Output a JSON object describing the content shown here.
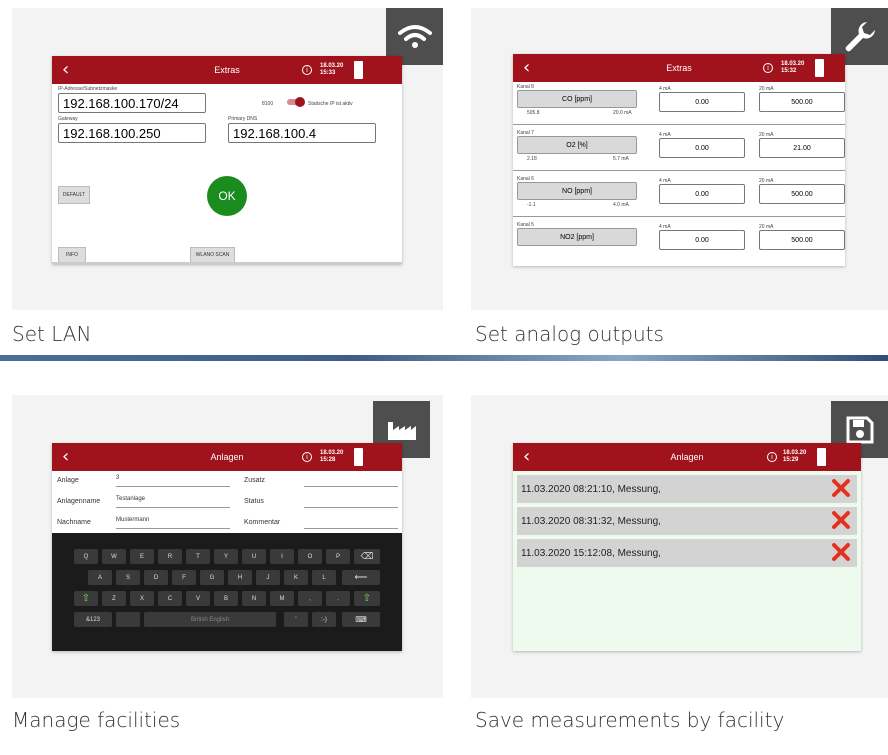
{
  "tiles": [
    {
      "caption": "Set LAN",
      "icon": "wifi-icon",
      "screen": {
        "title": "Extras",
        "date": "18.03.20",
        "time": "15:33",
        "ip_label": "IP-Adresse/Subnetzmaske",
        "ip_value": "192.168.100.170/24",
        "port": "8100",
        "static_label": "Statische IP ist aktiv",
        "gateway_label": "Gateway",
        "gateway_value": "192.168.100.250",
        "dns_label": "Primary DNS",
        "dns_value": "192.168.100.4",
        "default_btn": "DEFAULT",
        "ok_btn": "OK",
        "info_btn": "INFO",
        "wlan_btn": "WLANO SCAN"
      }
    },
    {
      "caption": "Set analog outputs",
      "icon": "wrench-icon",
      "screen": {
        "title": "Extras",
        "date": "18.03.20",
        "time": "15:32",
        "channels": [
          {
            "kanal": "Kanal 8",
            "name": "CO [ppm]",
            "min": "505.8",
            "max": "20.0  mA",
            "ma4_label": "4 mA",
            "ma4": "0.00",
            "ma20_label": "20 mA",
            "ma20": "500.00"
          },
          {
            "kanal": "Kanal 7",
            "name": "O2 [%]",
            "min": "2.18",
            "max": "5.7  mA",
            "ma4_label": "4 mA",
            "ma4": "0.00",
            "ma20_label": "20 mA",
            "ma20": "21.00"
          },
          {
            "kanal": "Kanal 6",
            "name": "NO [ppm]",
            "min": "-1.1",
            "max": "4.0  mA",
            "ma4_label": "4 mA",
            "ma4": "0.00",
            "ma20_label": "20 mA",
            "ma20": "500.00"
          },
          {
            "kanal": "Kanal 5",
            "name": "NO2 [ppm]",
            "min": "",
            "max": "",
            "ma4_label": "4 mA",
            "ma4": "0.00",
            "ma20_label": "20 mA",
            "ma20": "500.00"
          }
        ]
      }
    },
    {
      "caption": "Manage facilities",
      "icon": "factory-icon",
      "screen": {
        "title": "Anlagen",
        "date": "18.03.20",
        "time": "15:28",
        "fields": [
          {
            "label": "Anlage",
            "value": "3",
            "label2": "Zusatz"
          },
          {
            "label": "Anlagenname",
            "value": "Testanlage",
            "label2": "Status"
          },
          {
            "label": "Nachname",
            "value": "Mustermann",
            "label2": "Kommentar"
          }
        ],
        "keys_row1": [
          "Q",
          "W",
          "E",
          "R",
          "T",
          "Y",
          "U",
          "I",
          "O",
          "P"
        ],
        "keys_row2": [
          "A",
          "S",
          "D",
          "F",
          "G",
          "H",
          "J",
          "K",
          "L"
        ],
        "keys_row3": [
          "Z",
          "X",
          "C",
          "V",
          "B",
          "N",
          "M",
          ",",
          "."
        ],
        "key_123": "&123",
        "space_label": "British English",
        "key_apos": "'",
        "key_smiley": ":-)"
      }
    },
    {
      "caption": "Save measurements by facility",
      "icon": "save-icon",
      "screen": {
        "title": "Anlagen",
        "date": "18.03.20",
        "time": "15:29",
        "rows": [
          "11.03.2020 08:21:10, Messung,",
          "11.03.2020 08:31:32, Messung,",
          "11.03.2020 15:12:08, Messung,"
        ]
      }
    }
  ],
  "colors": {
    "accent": "#a0131c",
    "ok": "#1a8c1e",
    "badge": "#4e4e4e"
  }
}
